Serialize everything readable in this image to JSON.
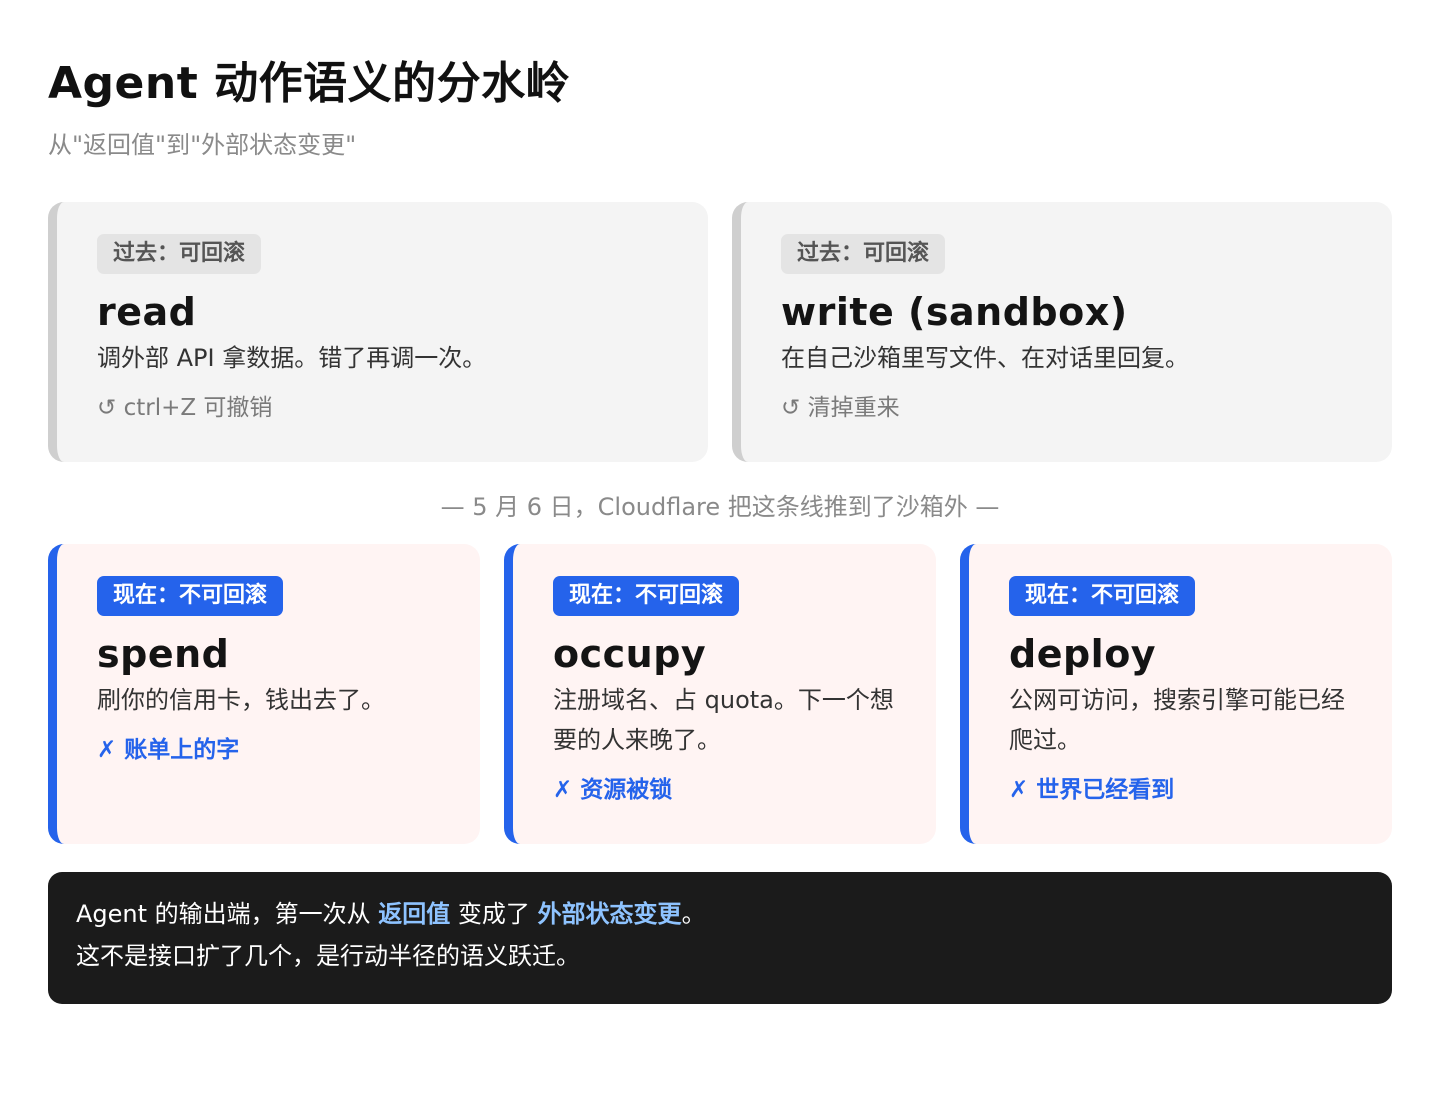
{
  "header": {
    "title": "Agent 动作语义的分水岭",
    "subtitle": "从\"返回值\"到\"外部状态变更\""
  },
  "past_cards": [
    {
      "badge": "过去：可回滚",
      "verb": "read",
      "desc": "调外部 API 拿数据。错了再调一次。",
      "note": "↺ ctrl+Z 可撤销"
    },
    {
      "badge": "过去：可回滚",
      "verb": "write (sandbox)",
      "desc": "在自己沙箱里写文件、在对话里回复。",
      "note": "↺ 清掉重来"
    }
  ],
  "divider": "— 5 月 6 日，Cloudflare 把这条线推到了沙箱外 —",
  "now_cards": [
    {
      "badge": "现在：不可回滚",
      "verb": "spend",
      "desc": "刷你的信用卡，钱出去了。",
      "note": "✗ 账单上的字"
    },
    {
      "badge": "现在：不可回滚",
      "verb": "occupy",
      "desc": "注册域名、占 quota。下一个想要的人来晚了。",
      "note": "✗ 资源被锁"
    },
    {
      "badge": "现在：不可回滚",
      "verb": "deploy",
      "desc": "公网可访问，搜索引擎可能已经爬过。",
      "note": "✗ 世界已经看到"
    }
  ],
  "summary": {
    "line1_a": "Agent 的输出端，第一次从 ",
    "line1_hl1": "返回值",
    "line1_b": " 变成了 ",
    "line1_hl2": "外部状态变更",
    "line1_c": "。",
    "line2": "这不是接口扩了几个，是行动半径的语义跃迁。"
  },
  "colors": {
    "accent": "#2563eb",
    "past_border": "#cfcfcf",
    "past_bg": "#f4f4f4",
    "now_bg": "#fff4f3",
    "summary_bg": "#1b1b1b",
    "summary_highlight": "#8ec3ff"
  }
}
